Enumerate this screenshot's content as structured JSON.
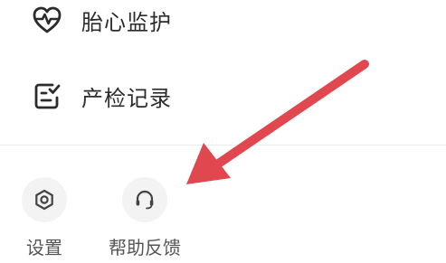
{
  "menu": {
    "items": [
      {
        "label": "胎心监护",
        "icon": "heart-pulse-icon"
      },
      {
        "label": "产检记录",
        "icon": "checklist-icon"
      }
    ]
  },
  "quick_actions": {
    "items": [
      {
        "label": "设置",
        "icon": "settings-icon"
      },
      {
        "label": "帮助反馈",
        "icon": "headset-icon"
      }
    ]
  },
  "annotation": {
    "arrow_color": "#e0474f"
  },
  "colors": {
    "text_primary": "#2b2b2b",
    "text_secondary": "#555555",
    "icon_bg": "#f3f3f3"
  }
}
